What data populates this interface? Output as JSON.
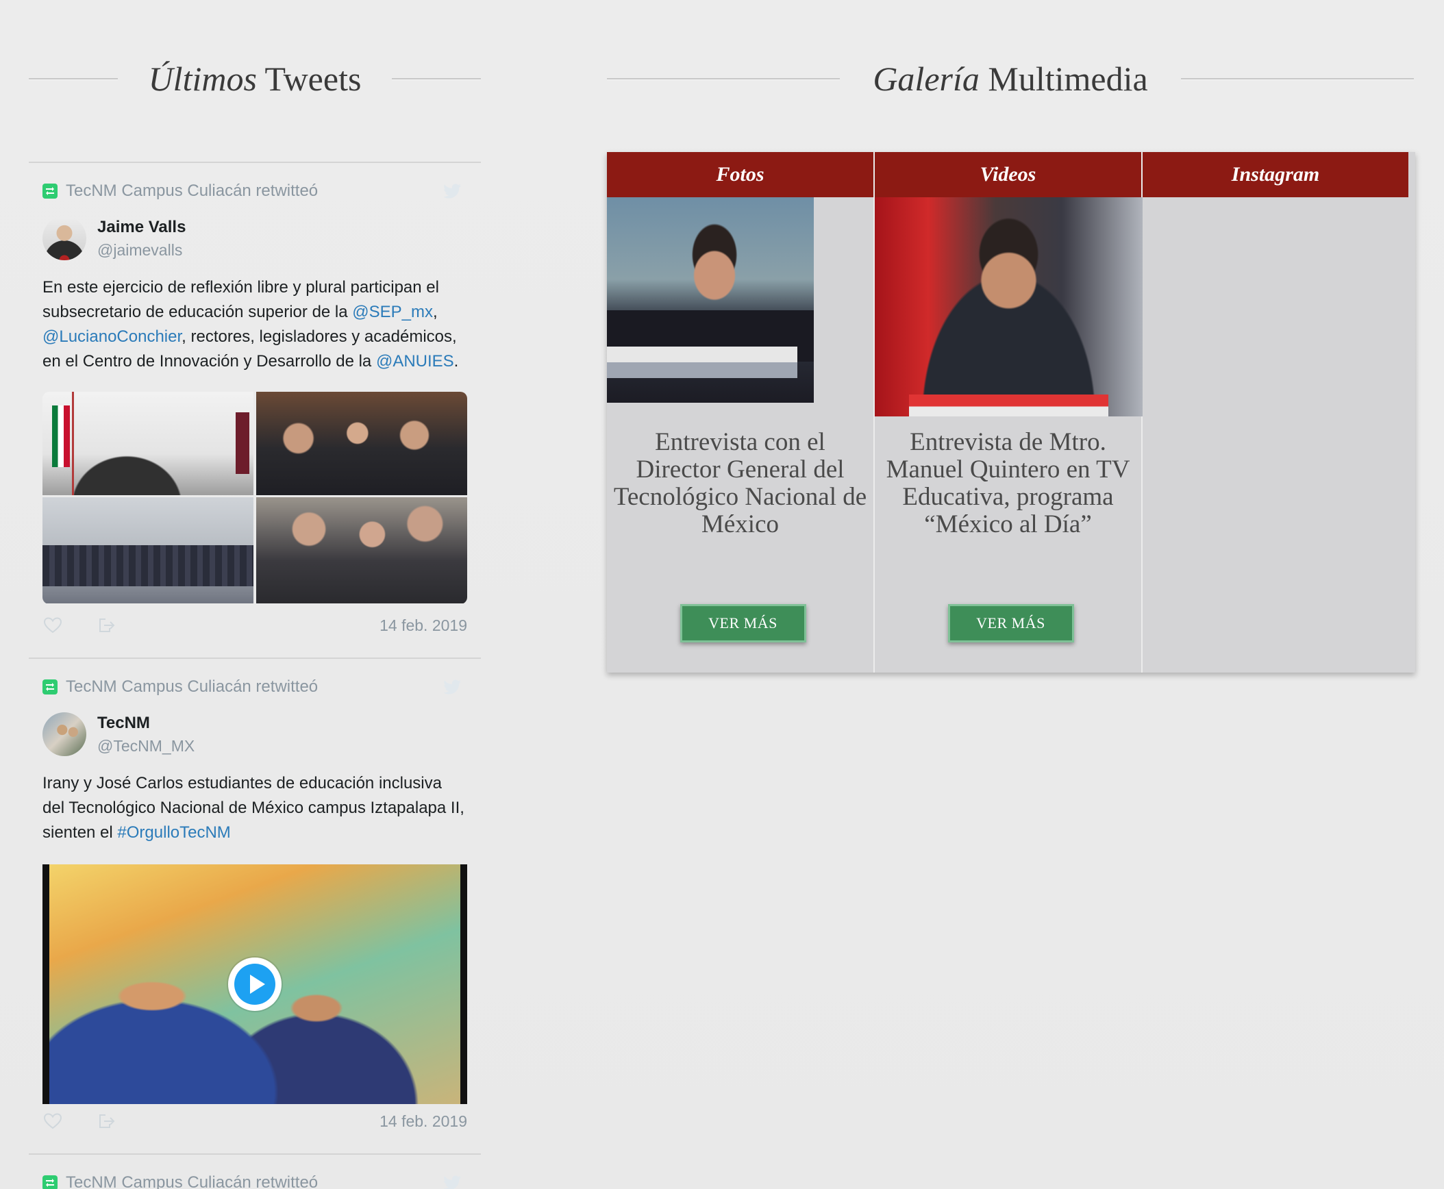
{
  "tweets_section": {
    "heading_italic": "Últimos",
    "heading_rest": " Tweets"
  },
  "gallery_section": {
    "heading_italic": "Galería",
    "heading_rest": " Multimedia"
  },
  "tweets": [
    {
      "retweet_label": "TecNM Campus Culiacán retwitteó",
      "author_name": "Jaime Valls",
      "author_handle": "@jaimevalls",
      "text_parts": [
        "En este ejercicio de reflexión libre y plural participan el subsecretario de educación superior de la ",
        "@SEP_mx",
        ", ",
        "@LucianoConchier",
        ", rectores, legisladores y académicos, en el Centro de Innovación y Desarrollo de la ",
        "@ANUIES",
        "."
      ],
      "date": "14 feb. 2019"
    },
    {
      "retweet_label": "TecNM Campus Culiacán retwitteó",
      "author_name": "TecNM",
      "author_handle": "@TecNM_MX",
      "text_parts": [
        "Irany y José Carlos estudiantes de educación inclusiva del Tecnológico Nacional de México campus Iztapalapa II, sienten el ",
        "#OrgulloTecNM"
      ],
      "date": "14 feb. 2019"
    },
    {
      "retweet_label": "TecNM Campus Culiacán retwitteó"
    }
  ],
  "gallery": {
    "fotos": {
      "header": "Fotos",
      "title": "Entrevista con el Director General del Tecnológico Nacional de México",
      "button": "VER MÁS"
    },
    "videos": {
      "header": "Videos",
      "title": "Entrevista de Mtro. Manuel Quintero en TV Educativa, programa “México al Día”",
      "button": "VER MÁS"
    },
    "instagram": {
      "header": "Instagram"
    }
  },
  "colors": {
    "header_red": "#8c1a13",
    "button_green": "#3e8e58",
    "mention_blue": "#2b7bb9",
    "retweet_green": "#2ecc71"
  },
  "icons": {
    "retweet": "retweet-icon",
    "twitter": "twitter-bird-icon",
    "like": "heart-icon",
    "share": "share-icon",
    "play": "play-icon"
  }
}
